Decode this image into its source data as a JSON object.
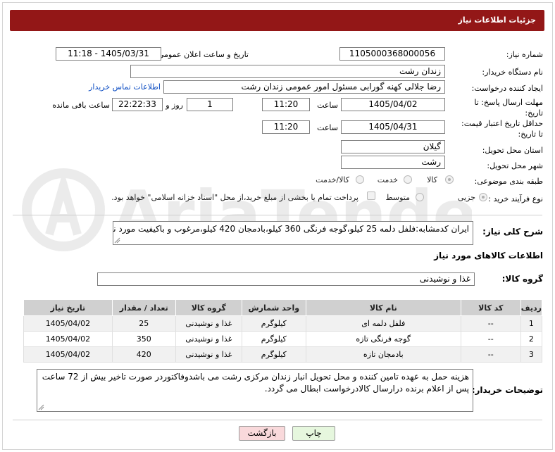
{
  "header": {
    "title": "جزئیات اطلاعات نیاز"
  },
  "form": {
    "need_number": {
      "label": "شماره نیاز:",
      "value": "1105000368000056"
    },
    "announce": {
      "label": "تاریخ و ساعت اعلان عمومی:",
      "value": "1405/03/31 - 11:18"
    },
    "buyer_org": {
      "label": "نام دستگاه خریدار:",
      "value": "زندان رشت"
    },
    "requester": {
      "label": "ایجاد کننده درخواست:",
      "value": "رضا جلالی کهنه گورابی مسئول امور عمومی زندان رشت",
      "contact_link": "اطلاعات تماس خریدار"
    },
    "reply_deadline": {
      "label_line1": "مهلت ارسال پاسخ: تا",
      "label_line2": "تاریخ:",
      "date": "1405/04/02",
      "time_label": "ساعت",
      "time": "11:20",
      "days": "1",
      "days_label": "روز و",
      "remaining": "22:22:33",
      "remaining_label": "ساعت باقی مانده"
    },
    "price_deadline": {
      "label_line1": "حداقل تاریخ اعتبار قیمت:",
      "label_line2": "تا تاریخ:",
      "date": "1405/04/31",
      "time_label": "ساعت",
      "time": "11:20"
    },
    "province": {
      "label": "استان محل تحویل:",
      "value": "گیلان"
    },
    "city": {
      "label": "شهر محل تحویل:",
      "value": "رشت"
    },
    "category": {
      "label": "طبقه بندی موضوعی:",
      "options": [
        "کالا",
        "خدمت",
        "کالا/خدمت"
      ],
      "selected": "کالا"
    },
    "process": {
      "label": "نوع فرآیند خرید :",
      "options": [
        "جزیی",
        "متوسط"
      ],
      "selected": "جزیی",
      "payment_note": "پرداخت تمام یا بخشی از مبلغ خرید،از محل \"اسناد خزانه اسلامی\" خواهد بود."
    }
  },
  "description": {
    "label": "شرح کلی نیاز:",
    "text": "ایران کدمشابه:فلفل دلمه 25 کیلو،گوجه فرنگی 360 کیلو،بادمجان 420 کیلو،مرغوب و باکیفیت مورد نیاز میباشد."
  },
  "goods": {
    "section_title": "اطلاعات کالاهای مورد نیاز",
    "group_label": "گروه کالا:",
    "group_value": "غذا و نوشیدنی",
    "columns": [
      "ردیف",
      "کد کالا",
      "نام کالا",
      "واحد شمارش",
      "گروه کالا",
      "تعداد / مقدار",
      "تاریخ نیاز"
    ],
    "rows": [
      [
        "1",
        "--",
        "فلفل دلمه ای",
        "کیلوگرم",
        "غذا و نوشیدنی",
        "25",
        "1405/04/02"
      ],
      [
        "2",
        "--",
        "گوجه فرنگی تازه",
        "کیلوگرم",
        "غذا و نوشیدنی",
        "350",
        "1405/04/02"
      ],
      [
        "3",
        "--",
        "بادمجان تازه",
        "کیلوگرم",
        "غذا و نوشیدنی",
        "420",
        "1405/04/02"
      ]
    ]
  },
  "buyer_notes": {
    "label": "توضیحات خریدار:",
    "text": "هزینه حمل به عهده تامین کننده و محل تحویل انبار زندان مرکزی رشت می باشدوفاکتوردر صورت تاخیر بیش از 72 ساعت پس از اعلام برنده درارسال کالادرخواست ابطال می گردد."
  },
  "buttons": {
    "print": "چاپ",
    "back": "بازگشت"
  },
  "watermark": {
    "text": "AriaTender.net"
  },
  "colors": {
    "title_bar": "#931717",
    "link": "#0b4cc2",
    "print_button": "#e6f7de",
    "back_button": "#f9d9db"
  }
}
